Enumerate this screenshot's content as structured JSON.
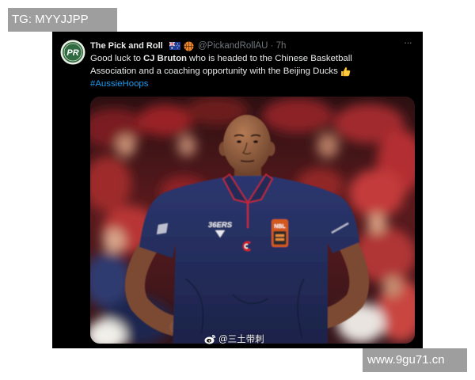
{
  "overlays": {
    "top_left_label": "TG: MYYJJPP",
    "bottom_right_label": "www.9gu71.cn"
  },
  "tweet": {
    "avatar_text": "PR",
    "author_name": "The Pick and Roll",
    "author_icons": [
      "australia-flag-icon",
      "basketball-icon"
    ],
    "handle": "@PickandRollAU",
    "separator": "·",
    "time": "7h",
    "more_label": "···",
    "text": {
      "line1_before": "Good luck to",
      "line1_bold": "CJ Bruton",
      "line1_after": "who is headed to the Chinese Basketball",
      "line2": "Association and a coaching opportunity with the Beijing Ducks",
      "emoji_icon": "thumbs-up-icon"
    },
    "hashtag": "#AussieHoops",
    "media": {
      "jersey_logo": "36ERS",
      "badge_text": "NBL",
      "watermark_icon": "weibo-icon",
      "watermark_text": "@三土带刺"
    }
  },
  "colors": {
    "card_background": "#000000",
    "text": "#e7e9ea",
    "muted": "#71767b",
    "hashtag": "#1d9bf0",
    "overlay_label_bg": "#9e9e9e",
    "shirt_navy": "#26305e",
    "collar_trim": "#c8252e"
  }
}
